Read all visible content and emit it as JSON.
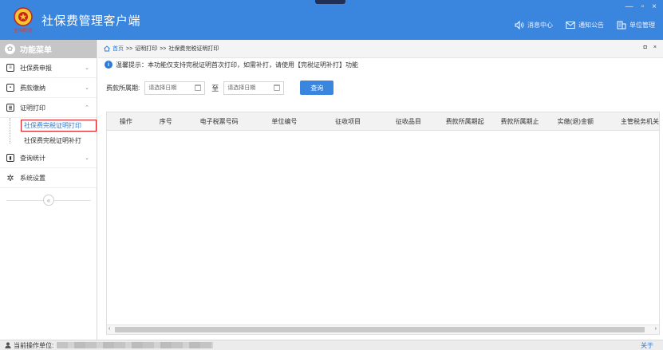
{
  "header": {
    "title": "社保费管理客户端",
    "logo_text": "全国税务",
    "window_controls": [
      "—",
      "▫",
      "×"
    ],
    "links": [
      {
        "label": "消息中心",
        "icon": "speaker-icon"
      },
      {
        "label": "通知公告",
        "icon": "mail-icon"
      },
      {
        "label": "单位管理",
        "icon": "building-icon"
      }
    ]
  },
  "sidebar": {
    "menu_title": "功能菜单",
    "items": [
      {
        "label": "社保费申报",
        "icon": "form-icon",
        "chevron": "⌄"
      },
      {
        "label": "费款缴纳",
        "icon": "payment-icon",
        "chevron": "⌄"
      },
      {
        "label": "证明打印",
        "icon": "print-icon",
        "chevron": "⌃",
        "children": [
          {
            "label": "社保费完税证明打印",
            "active": true
          },
          {
            "label": "社保费完税证明补打",
            "active": false
          }
        ]
      },
      {
        "label": "查询统计",
        "icon": "chart-icon",
        "chevron": "⌄"
      },
      {
        "label": "系统设置",
        "icon": "gear-icon",
        "chevron": ""
      }
    ],
    "collapse_symbol": "«"
  },
  "breadcrumb": {
    "home": "首页",
    "separator": ">>",
    "level1": "证明打印",
    "level2": "社保费完税证明打印",
    "controls": [
      "◘",
      "×"
    ]
  },
  "notice": {
    "text": "温馨提示：本功能仅支持完税证明首次打印，如需补打，请使用【完税证明补打】功能"
  },
  "filter": {
    "label": "费款所属期:",
    "start_placeholder": "请选择日期",
    "to": "至",
    "end_placeholder": "请选择日期",
    "query_label": "查询"
  },
  "table": {
    "columns": [
      "操作",
      "序号",
      "电子税票号码",
      "单位编号",
      "征收项目",
      "征收品目",
      "费款所属期起",
      "费款所属期止",
      "实缴(退)金额",
      "主管税务机关"
    ],
    "rows": []
  },
  "statusbar": {
    "operator_label": "当前操作单位:",
    "about": "关于"
  },
  "colors": {
    "header_bg": "#3a85de",
    "accent": "#2d7ad6",
    "highlight_border": "#e1141a"
  }
}
